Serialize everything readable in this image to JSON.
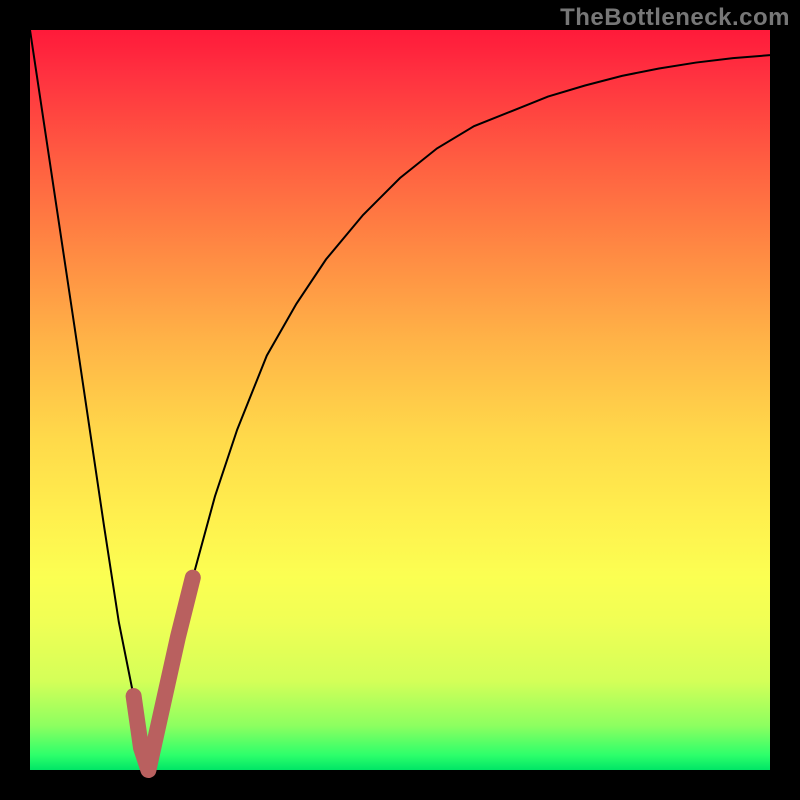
{
  "watermark": "TheBottleneck.com",
  "chart_data": {
    "type": "line",
    "title": "",
    "xlabel": "",
    "ylabel": "",
    "xlim": [
      0,
      100
    ],
    "ylim": [
      0,
      100
    ],
    "series": [
      {
        "name": "main-curve",
        "x": [
          0,
          6,
          10,
          12,
          14,
          15,
          16,
          18,
          20,
          22,
          25,
          28,
          32,
          36,
          40,
          45,
          50,
          55,
          60,
          65,
          70,
          75,
          80,
          85,
          90,
          95,
          100
        ],
        "values": [
          100,
          60,
          33,
          20,
          10,
          3,
          0,
          9,
          18,
          26,
          37,
          46,
          56,
          63,
          69,
          75,
          80,
          84,
          87,
          89,
          91,
          92.5,
          93.8,
          94.8,
          95.6,
          96.2,
          96.6
        ]
      },
      {
        "name": "highlight-segment",
        "x": [
          14,
          15,
          16,
          18,
          20,
          22
        ],
        "values": [
          10,
          3,
          0,
          9,
          18,
          26
        ]
      }
    ]
  },
  "colors": {
    "curve": "#000000",
    "highlight": "#b9605f",
    "frame": "#000000"
  }
}
